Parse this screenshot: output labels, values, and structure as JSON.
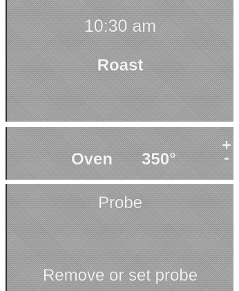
{
  "status": {
    "time": "10:30 am",
    "mode": "Roast"
  },
  "oven": {
    "label": "Oven",
    "temperature": "350°",
    "increase_label": "+",
    "decrease_label": "-"
  },
  "probe": {
    "title": "Probe",
    "message": "Remove or set probe"
  }
}
